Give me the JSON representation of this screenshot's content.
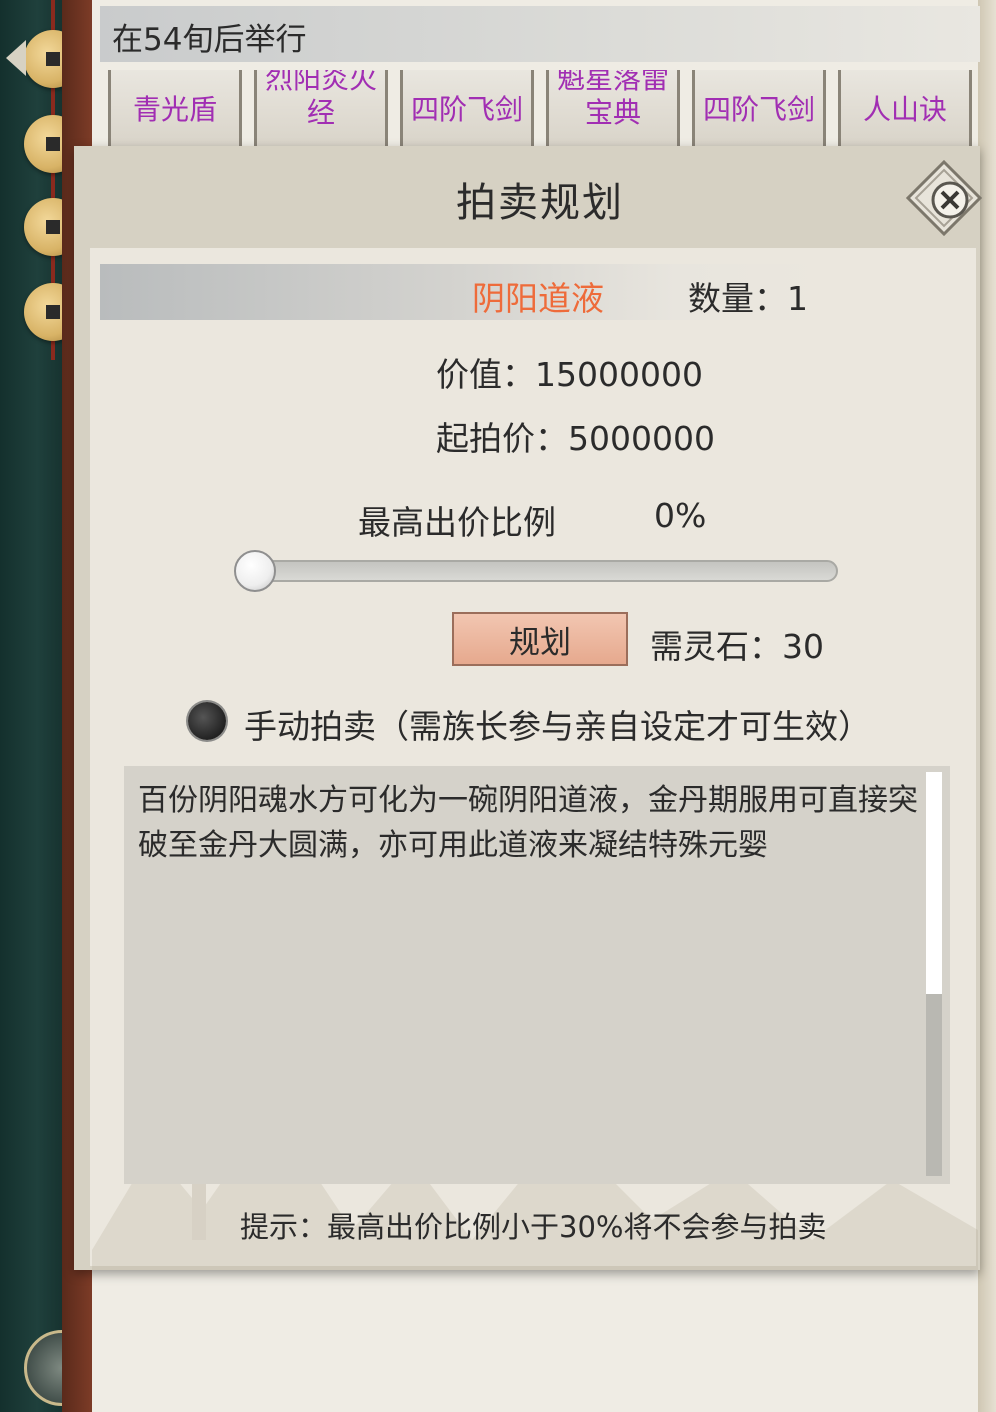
{
  "header": {
    "event_text": "在54旬后举行"
  },
  "tabs": [
    {
      "line1": "青光盾",
      "line2": ""
    },
    {
      "line1": "烈阳炎火",
      "line2": "经"
    },
    {
      "line1": "四阶飞剑",
      "line2": ""
    },
    {
      "line1": "魁星落雷",
      "line2": "宝典"
    },
    {
      "line1": "四阶飞剑",
      "line2": ""
    },
    {
      "line1": "人山诀",
      "line2": ""
    }
  ],
  "modal": {
    "title": "拍卖规划",
    "item_name": "阴阳道液",
    "quantity_text": "数量：1",
    "value_text": "价值：15000000",
    "start_price_text": "起拍价：5000000",
    "bid_ratio_label": "最高出价比例",
    "bid_ratio_value": "0%",
    "bid_ratio_fraction": 0,
    "plan_button": "规划",
    "spirit_stone_text": "需灵石：30",
    "manual_auction_text": "手动拍卖（需族长参与亲自设定才可生效）",
    "description": "百份阴阳魂水方可化为一碗阴阳道液，金丹期服用可直接突破至金丹大圆满，亦可用此道液来凝结特殊元婴",
    "hint": "提示：最高出价比例小于30%将不会参与拍卖"
  },
  "colors": {
    "item_name": "#ee6b3a",
    "tab_text": "#a12eb3",
    "plan_button_bg": "#e6a98e"
  },
  "icons": {
    "close": "close-icon",
    "back": "back-arrow-icon"
  }
}
